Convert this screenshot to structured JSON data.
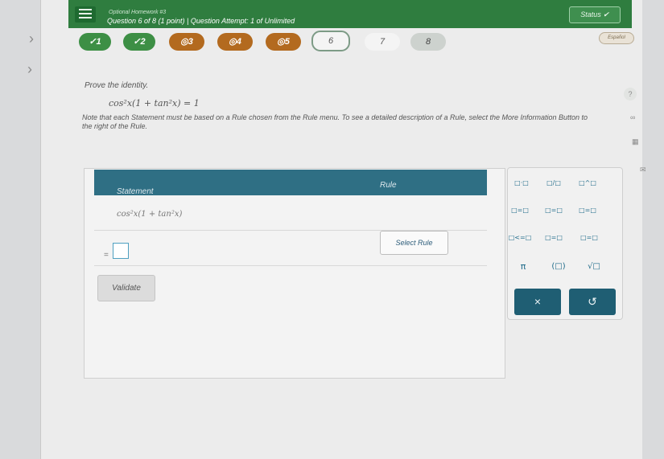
{
  "header": {
    "assignment_label": "Optional Homework #3",
    "question_info": "Question 6 of 8 (1 point) | Question Attempt: 1 of Unlimited",
    "status_button": "Status"
  },
  "question_nav": {
    "items": [
      {
        "label": "✓1",
        "state": "correct"
      },
      {
        "label": "✓2",
        "state": "correct"
      },
      {
        "label": "◎3",
        "state": "partial"
      },
      {
        "label": "◎4",
        "state": "partial"
      },
      {
        "label": "◎5",
        "state": "partial"
      },
      {
        "label": "6",
        "state": "current"
      },
      {
        "label": "7",
        "state": "unanswered"
      },
      {
        "label": "8",
        "state": "unanswered-gray"
      }
    ],
    "language_button": "Español"
  },
  "problem": {
    "prompt": "Prove the identity.",
    "identity": "cos²x(1 + tan²x) = 1",
    "note": "Note that each Statement must be based on a Rule chosen from the Rule menu. To see a detailed description of a Rule, select the More Information Button to the right of the Rule."
  },
  "proof": {
    "statement_header": "Statement",
    "rule_header": "Rule",
    "rows": [
      {
        "statement": "cos²x(1 + tan²x)"
      },
      {
        "prefix": "="
      }
    ],
    "select_rule_label": "Select Rule",
    "validate_label": "Validate"
  },
  "palette": {
    "buttons": [
      "□·□",
      "□/□",
      "□^□",
      "□=□",
      "□=□",
      "□=□",
      "□<=□",
      "□=□",
      "□=□",
      "π",
      "(□)",
      "√□"
    ],
    "clear_label": "×",
    "undo_label": "↺"
  },
  "sidebar_icons": [
    "help-icon",
    "infinity-icon",
    "calculator-icon",
    "mail-icon"
  ],
  "colors": {
    "header_green": "#2f7d3f",
    "table_header": "#2f6f84",
    "correct_green": "#3d8f45",
    "partial_orange": "#b36a1f",
    "action_teal": "#1f5e73"
  }
}
